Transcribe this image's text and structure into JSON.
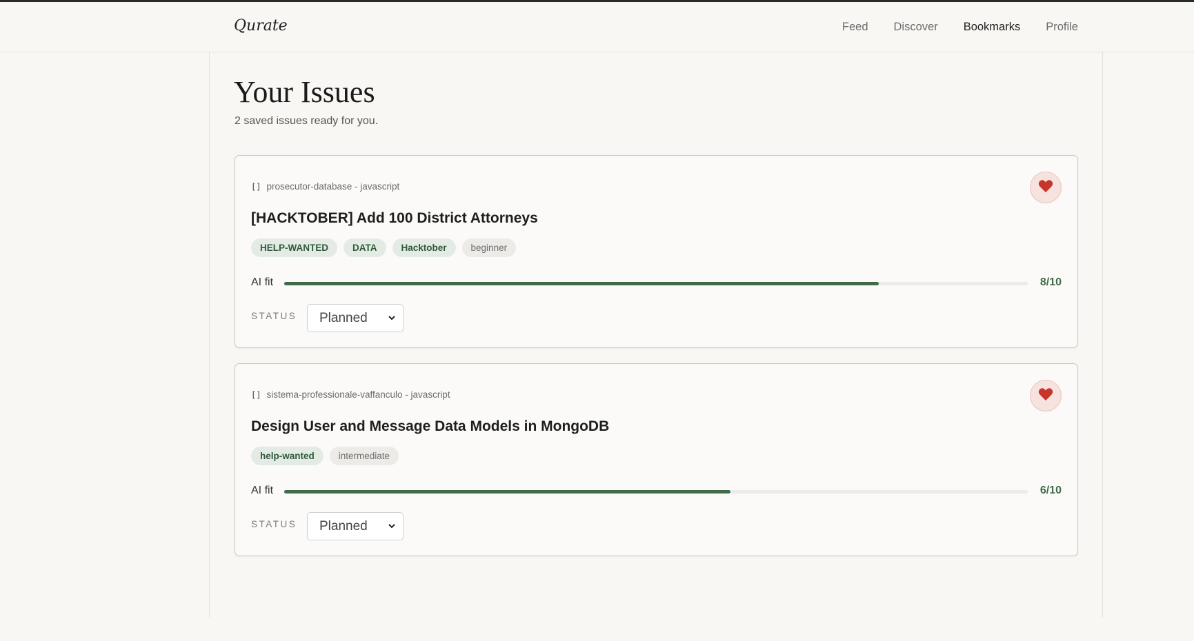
{
  "nav": {
    "brand": "Qurate",
    "links": [
      "Feed",
      "Discover",
      "Bookmarks",
      "Profile"
    ],
    "active": "Bookmarks"
  },
  "page": {
    "title": "Your Issues",
    "subtitle": "2 saved issues ready for you."
  },
  "issues": [
    {
      "icon": "[]",
      "repo": "prosecutor-database - javascript",
      "title": "[HACKTOBER] Add 100 District Attorneys",
      "tags": [
        {
          "label": "HELP-WANTED",
          "style": "green"
        },
        {
          "label": "DATA",
          "style": "green"
        },
        {
          "label": "Hacktober",
          "style": "green"
        },
        {
          "label": "beginner",
          "style": "grey"
        }
      ],
      "fit_label": "AI fit",
      "fit_score": "8/10",
      "fit_fraction": 0.8,
      "status_label": "STATUS",
      "status_value": "Planned",
      "bookmarked": true
    },
    {
      "icon": "[]",
      "repo": "sistema-professionale-vaffanculo - javascript",
      "title": "Design User and Message Data Models in MongoDB",
      "tags": [
        {
          "label": "help-wanted",
          "style": "green"
        },
        {
          "label": "intermediate",
          "style": "grey"
        }
      ],
      "fit_label": "AI fit",
      "fit_score": "6/10",
      "fit_fraction": 0.6,
      "status_label": "STATUS",
      "status_value": "Planned",
      "bookmarked": true
    }
  ],
  "colors": {
    "accent": "#3f6b4a",
    "heart": "#c8352b",
    "background": "#f8f7f4"
  }
}
